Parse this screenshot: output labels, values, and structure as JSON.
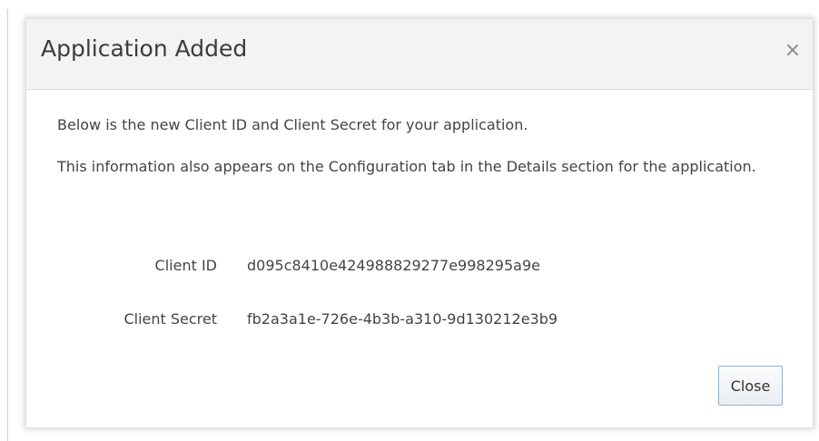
{
  "dialog": {
    "title": "Application Added",
    "close_icon_glyph": "×",
    "message_1": "Below is the new Client ID and Client Secret for your application.",
    "message_2": "This information also appears on the Configuration tab in the Details section for the application.",
    "fields": [
      {
        "label": "Client ID",
        "value": "d095c8410e424988829277e998295a9e"
      },
      {
        "label": "Client Secret",
        "value": "fb2a3a1e-726e-4b3b-a310-9d130212e3b9"
      }
    ],
    "close_button_label": "Close"
  },
  "colors": {
    "header_background": "#f3f3f3",
    "text": "#444444",
    "button_border": "#8fb4cf"
  },
  "icons": {
    "close": "close-icon"
  }
}
